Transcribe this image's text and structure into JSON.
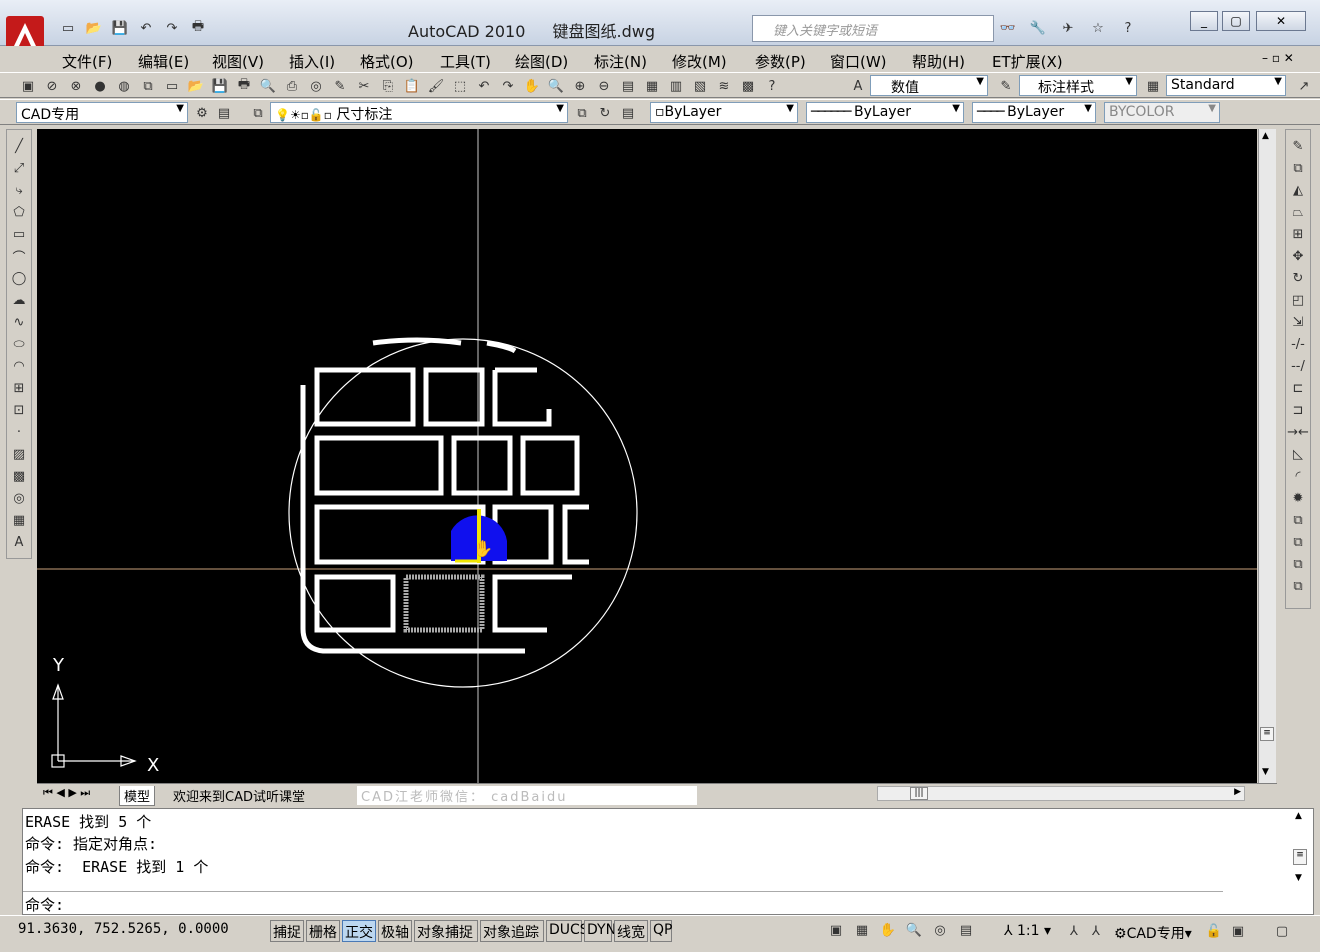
{
  "titlebar": {
    "app_name": "AutoCAD 2010",
    "file_name": "键盘图纸.dwg",
    "search_placeholder": "键入关键字或短语"
  },
  "menubar": {
    "items": [
      "文件(F)",
      "编辑(E)",
      "视图(V)",
      "插入(I)",
      "格式(O)",
      "工具(T)",
      "绘图(D)",
      "标注(N)",
      "修改(M)",
      "参数(P)",
      "窗口(W)",
      "帮助(H)",
      "ET扩展(X)"
    ]
  },
  "toolbar": {
    "text_style_value": "数值",
    "dim_style_value": "标注样式",
    "table_style_value": "Standard",
    "workspace_value": "CAD专用",
    "layer_value": "尺寸标注",
    "color_value": "ByLayer",
    "linetype_value": "ByLayer",
    "lineweight_value": "ByLayer",
    "plotstyle_value": "BYCOLOR"
  },
  "drawing": {
    "ucs_x_label": "X",
    "ucs_y_label": "Y"
  },
  "tabs": {
    "model": "模型",
    "layout": "欢迎来到CAD试听课堂",
    "watermark": "CAD江老师微信： cadBaidu"
  },
  "command": {
    "history": [
      "ERASE 找到 5 个",
      "命令: 指定对角点:",
      "命令:  ERASE 找到 1 个"
    ],
    "prompt": "命令:"
  },
  "status": {
    "coordinates": "91.3630,  752.5265,  0.0000",
    "toggles": [
      {
        "label": "捕捉",
        "on": false
      },
      {
        "label": "栅格",
        "on": false
      },
      {
        "label": "正交",
        "on": true
      },
      {
        "label": "极轴",
        "on": false
      },
      {
        "label": "对象捕捉",
        "on": false
      },
      {
        "label": "对象追踪",
        "on": false
      },
      {
        "label": "DUCS",
        "on": false
      },
      {
        "label": "DYN",
        "on": false
      },
      {
        "label": "线宽",
        "on": false
      },
      {
        "label": "QP",
        "on": false
      }
    ],
    "annotation_scale": "1:1",
    "workspace_label": "CAD专用"
  },
  "colors": {
    "canvas_bg": "#000000",
    "crosshair": "#c8a07a",
    "ortho_on": "#bcd7f0",
    "cursor_blue": "#1010ee",
    "highlight_yellow": "#f2e600"
  }
}
